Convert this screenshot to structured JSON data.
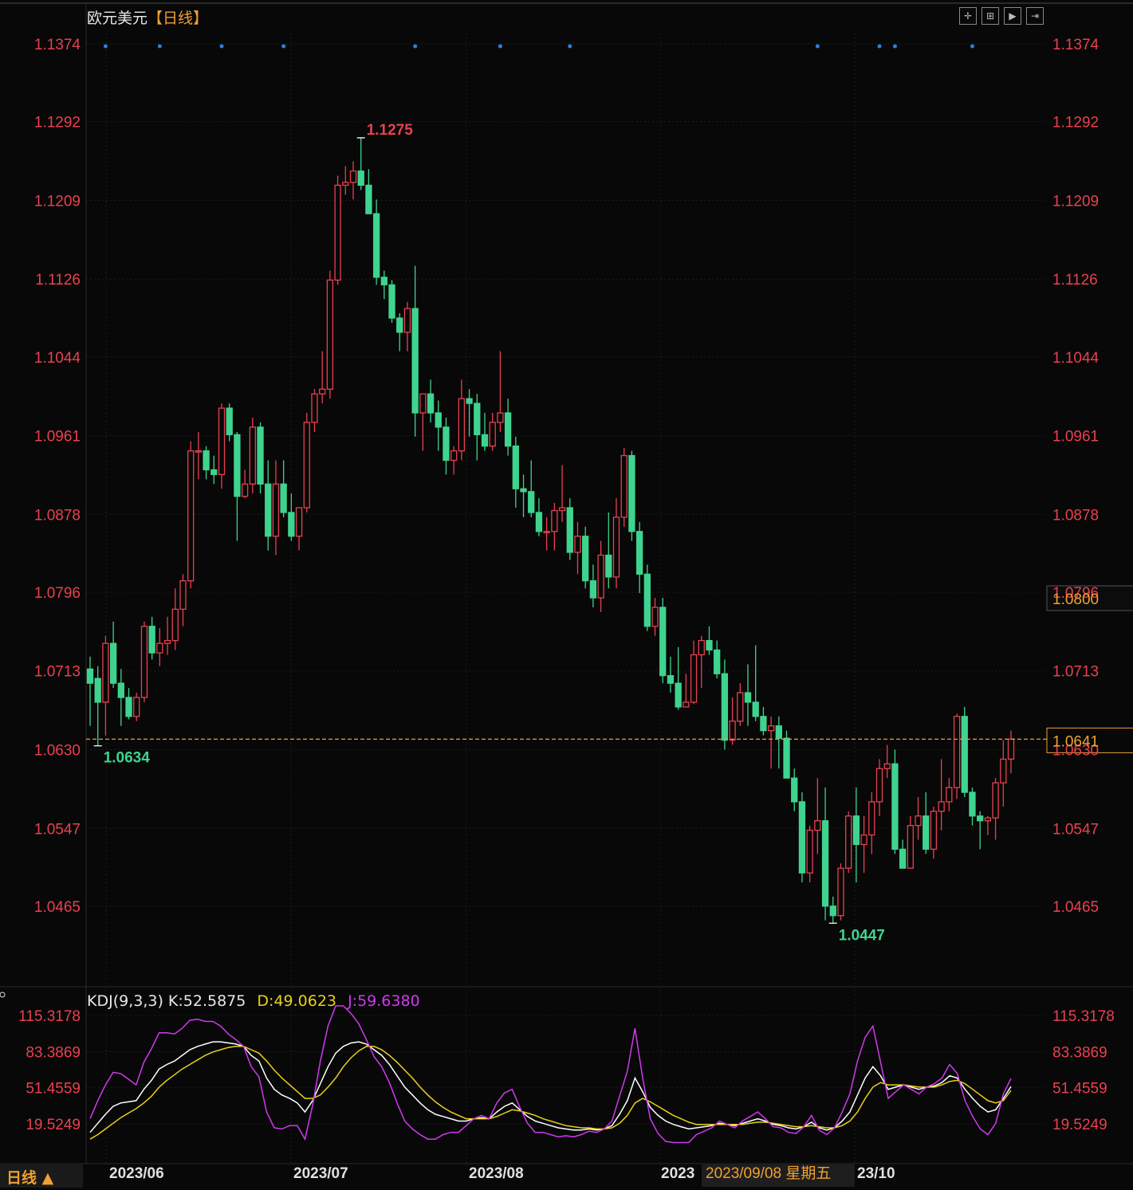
{
  "chart_title": "欧元美元",
  "period_tag": "【日线】",
  "indicator": {
    "name": "KDJ(9,3,3)",
    "k_label": "K:52.5875",
    "d_label": "D:49.0623",
    "j_label": "J:59.6380",
    "y_ticks": [
      "115.3178",
      "83.3869",
      "51.4559",
      "19.5249"
    ]
  },
  "bottom": {
    "period_label": "日线 ▲",
    "date_labels": [
      "2023/06",
      "2023/07",
      "2023/08",
      "2023",
      "23/10"
    ],
    "crosshair_date": "2023/09/08 星期五"
  },
  "price_tag_current": "1.0641",
  "price_tag_cursor": "1.0800",
  "toolbar_icons": [
    "crosshair-icon",
    "zoom-icon",
    "play-icon",
    "step-icon"
  ],
  "colors": {
    "up": "#e8414f",
    "down": "#3ed48f",
    "k": "#ffffff",
    "d": "#e8d21a",
    "j": "#d238f0",
    "current_line": "#f0a030",
    "axis_text": "#e8414f",
    "dot": "#2a82e0",
    "grid": "#1c1c1c"
  },
  "chart_data": [
    {
      "type": "candlestick",
      "series_name": "欧元美元",
      "y_ticks": [
        "1.1374",
        "1.1292",
        "1.1209",
        "1.1126",
        "1.1044",
        "1.0961",
        "1.0878",
        "1.0796",
        "1.0713",
        "1.0630",
        "1.0547",
        "1.0465"
      ],
      "ylim": [
        1.038,
        1.1385
      ],
      "annotations": {
        "high": "1.1275",
        "low": "1.0634",
        "low2": "1.0447"
      },
      "current_price": 1.0641,
      "candles": [
        [
          1.0715,
          1.0728,
          1.0655,
          1.07
        ],
        [
          1.0705,
          1.0718,
          1.0634,
          1.068
        ],
        [
          1.068,
          1.075,
          1.0645,
          1.0742
        ],
        [
          1.0742,
          1.0765,
          1.0695,
          1.07
        ],
        [
          1.07,
          1.0715,
          1.0655,
          1.0685
        ],
        [
          1.0685,
          1.0695,
          1.0662,
          1.0665
        ],
        [
          1.0665,
          1.069,
          1.066,
          1.0685
        ],
        [
          1.0685,
          1.0765,
          1.068,
          1.076
        ],
        [
          1.076,
          1.077,
          1.0725,
          1.0732
        ],
        [
          1.0732,
          1.0758,
          1.0718,
          1.0742
        ],
        [
          1.0742,
          1.077,
          1.073,
          1.0745
        ],
        [
          1.0745,
          1.08,
          1.0735,
          1.0778
        ],
        [
          1.0778,
          1.0815,
          1.076,
          1.0808
        ],
        [
          1.0808,
          1.0955,
          1.08,
          1.0945
        ],
        [
          1.0945,
          1.0965,
          1.0915,
          1.0945
        ],
        [
          1.0945,
          1.095,
          1.0915,
          1.0925
        ],
        [
          1.0925,
          1.094,
          1.091,
          1.092
        ],
        [
          1.092,
          1.0995,
          1.0905,
          1.099
        ],
        [
          1.099,
          1.0995,
          1.0955,
          1.0962
        ],
        [
          1.0962,
          1.0965,
          1.085,
          1.0897
        ],
        [
          1.0897,
          1.0925,
          1.0895,
          1.091
        ],
        [
          1.091,
          1.098,
          1.09,
          1.097
        ],
        [
          1.097,
          1.0975,
          1.09,
          1.091
        ],
        [
          1.091,
          1.0935,
          1.084,
          1.0855
        ],
        [
          1.0855,
          1.0935,
          1.0835,
          1.091
        ],
        [
          1.091,
          1.0935,
          1.0875,
          1.088
        ],
        [
          1.088,
          1.09,
          1.085,
          1.0855
        ],
        [
          1.0855,
          1.0885,
          1.084,
          1.0885
        ],
        [
          1.0885,
          1.0985,
          1.088,
          1.0975
        ],
        [
          1.0975,
          1.101,
          1.0965,
          1.1005
        ],
        [
          1.1005,
          1.105,
          1.0995,
          1.101
        ],
        [
          1.101,
          1.1135,
          1.1,
          1.1125
        ],
        [
          1.1125,
          1.1235,
          1.112,
          1.1225
        ],
        [
          1.1225,
          1.1245,
          1.1215,
          1.1228
        ],
        [
          1.1228,
          1.125,
          1.121,
          1.124
        ],
        [
          1.124,
          1.1275,
          1.122,
          1.1225
        ],
        [
          1.1225,
          1.1242,
          1.1195,
          1.1195
        ],
        [
          1.1195,
          1.121,
          1.112,
          1.1128
        ],
        [
          1.1128,
          1.1135,
          1.1105,
          1.112
        ],
        [
          1.112,
          1.1125,
          1.108,
          1.1085
        ],
        [
          1.1085,
          1.109,
          1.105,
          1.107
        ],
        [
          1.107,
          1.1102,
          1.105,
          1.1095
        ],
        [
          1.1095,
          1.114,
          1.096,
          1.0985
        ],
        [
          1.0985,
          1.1005,
          1.0945,
          1.1005
        ],
        [
          1.1005,
          1.102,
          1.0975,
          1.0985
        ],
        [
          1.0985,
          1.0998,
          1.0945,
          1.097
        ],
        [
          1.097,
          1.098,
          1.092,
          1.0935
        ],
        [
          1.0935,
          1.095,
          1.092,
          1.0945
        ],
        [
          1.0945,
          1.102,
          1.0935,
          1.1
        ],
        [
          1.1,
          1.101,
          1.096,
          1.0995
        ],
        [
          1.0995,
          1.1005,
          1.0935,
          1.0962
        ],
        [
          1.0962,
          1.0985,
          1.0945,
          1.095
        ],
        [
          1.095,
          1.0985,
          1.0945,
          1.0975
        ],
        [
          1.0975,
          1.105,
          1.0965,
          1.0985
        ],
        [
          1.0985,
          1.1,
          1.094,
          1.095
        ],
        [
          1.095,
          1.096,
          1.0885,
          1.0905
        ],
        [
          1.0905,
          1.092,
          1.0875,
          1.0902
        ],
        [
          1.0902,
          1.0935,
          1.0875,
          1.088
        ],
        [
          1.088,
          1.0895,
          1.0855,
          1.086
        ],
        [
          1.086,
          1.0875,
          1.084,
          1.086
        ],
        [
          1.086,
          1.089,
          1.084,
          1.0882
        ],
        [
          1.0882,
          1.093,
          1.087,
          1.0885
        ],
        [
          1.0885,
          1.0895,
          1.083,
          1.0838
        ],
        [
          1.0838,
          1.087,
          1.0815,
          1.0855
        ],
        [
          1.0855,
          1.0865,
          1.08,
          1.0808
        ],
        [
          1.0808,
          1.0825,
          1.078,
          1.079
        ],
        [
          1.079,
          1.085,
          1.0775,
          1.0835
        ],
        [
          1.0835,
          1.088,
          1.08,
          1.0812
        ],
        [
          1.0812,
          1.0895,
          1.08,
          1.0875
        ],
        [
          1.0875,
          1.0948,
          1.0865,
          1.094
        ],
        [
          1.094,
          1.0945,
          1.085,
          1.086
        ],
        [
          1.086,
          1.087,
          1.0795,
          1.0815
        ],
        [
          1.0815,
          1.0825,
          1.0755,
          1.076
        ],
        [
          1.076,
          1.079,
          1.075,
          1.078
        ],
        [
          1.078,
          1.079,
          1.07,
          1.0708
        ],
        [
          1.0708,
          1.0728,
          1.069,
          1.07
        ],
        [
          1.07,
          1.0738,
          1.0672,
          1.0675
        ],
        [
          1.0675,
          1.071,
          1.068,
          1.068
        ],
        [
          1.068,
          1.0745,
          1.0678,
          1.073
        ],
        [
          1.073,
          1.075,
          1.0695,
          1.0745
        ],
        [
          1.0745,
          1.076,
          1.073,
          1.0735
        ],
        [
          1.0735,
          1.0745,
          1.0705,
          1.071
        ],
        [
          1.071,
          1.0725,
          1.063,
          1.064
        ],
        [
          1.064,
          1.0685,
          1.0635,
          1.066
        ],
        [
          1.066,
          1.07,
          1.0655,
          1.069
        ],
        [
          1.069,
          1.072,
          1.0655,
          1.068
        ],
        [
          1.068,
          1.074,
          1.066,
          1.0665
        ],
        [
          1.0665,
          1.0675,
          1.0645,
          1.065
        ],
        [
          1.065,
          1.0665,
          1.061,
          1.0655
        ],
        [
          1.0655,
          1.0665,
          1.061,
          1.0642
        ],
        [
          1.0642,
          1.065,
          1.06,
          1.06
        ],
        [
          1.06,
          1.061,
          1.0565,
          1.0575
        ],
        [
          1.0575,
          1.0585,
          1.049,
          1.05
        ],
        [
          1.05,
          1.055,
          1.049,
          1.0545
        ],
        [
          1.0545,
          1.06,
          1.052,
          1.0555
        ],
        [
          1.0555,
          1.059,
          1.045,
          1.0465
        ],
        [
          1.0465,
          1.0475,
          1.0447,
          1.0455
        ],
        [
          1.0455,
          1.051,
          1.045,
          1.0505
        ],
        [
          1.0505,
          1.0565,
          1.05,
          1.056
        ],
        [
          1.056,
          1.059,
          1.049,
          1.053
        ],
        [
          1.053,
          1.056,
          1.05,
          1.054
        ],
        [
          1.054,
          1.0585,
          1.052,
          1.0575
        ],
        [
          1.0575,
          1.062,
          1.056,
          1.061
        ],
        [
          1.061,
          1.0635,
          1.06,
          1.0615
        ],
        [
          1.0615,
          1.063,
          1.052,
          1.0525
        ],
        [
          1.0525,
          1.0535,
          1.0505,
          1.0505
        ],
        [
          1.0505,
          1.056,
          1.0515,
          1.055
        ],
        [
          1.055,
          1.058,
          1.0535,
          1.056
        ],
        [
          1.056,
          1.0585,
          1.052,
          1.0525
        ],
        [
          1.0525,
          1.057,
          1.0515,
          1.0565
        ],
        [
          1.0565,
          1.062,
          1.0545,
          1.0575
        ],
        [
          1.0575,
          1.06,
          1.0565,
          1.059
        ],
        [
          1.059,
          1.0668,
          1.0578,
          1.0665
        ],
        [
          1.0665,
          1.0675,
          1.058,
          1.0585
        ],
        [
          1.0585,
          1.059,
          1.055,
          1.056
        ],
        [
          1.056,
          1.0565,
          1.0525,
          1.0555
        ],
        [
          1.0555,
          1.056,
          1.054,
          1.0558
        ],
        [
          1.0558,
          1.06,
          1.0535,
          1.0595
        ],
        [
          1.0595,
          1.064,
          1.057,
          1.062
        ],
        [
          1.062,
          1.065,
          1.0605,
          1.0641
        ]
      ],
      "blue_dot_indices": [
        2,
        9,
        17,
        25,
        42,
        53,
        62,
        94,
        102,
        104,
        114
      ]
    },
    {
      "type": "line",
      "series_name": "KDJ(9,3,3)",
      "y_ticks": [
        "115.3178",
        "83.3869",
        "51.4559",
        "19.5249"
      ],
      "ylim": [
        -12.0,
        125.0
      ],
      "series": [
        {
          "name": "K",
          "values": [
            12,
            20,
            28,
            35,
            38,
            39,
            40,
            50,
            58,
            68,
            72,
            75,
            80,
            85,
            88,
            90,
            92,
            92,
            91,
            90,
            88,
            80,
            75,
            60,
            50,
            45,
            42,
            38,
            30,
            40,
            55,
            70,
            82,
            88,
            91,
            92,
            90,
            85,
            80,
            72,
            62,
            52,
            45,
            38,
            32,
            28,
            26,
            24,
            22,
            22,
            24,
            25,
            24,
            30,
            35,
            38,
            32,
            26,
            22,
            20,
            18,
            16,
            15,
            14,
            14,
            15,
            14,
            15,
            18,
            28,
            40,
            60,
            48,
            34,
            27,
            22,
            19,
            17,
            15,
            16,
            17,
            18,
            20,
            19,
            18,
            20,
            22,
            24,
            22,
            19,
            18,
            16,
            15,
            17,
            21,
            16,
            14,
            16,
            22,
            30,
            45,
            60,
            70,
            62,
            50,
            52,
            54,
            52,
            50,
            52,
            53,
            56,
            62,
            60,
            50,
            42,
            35,
            30,
            32,
            42,
            52.5875
          ]
        },
        {
          "name": "D",
          "values": [
            6,
            10,
            15,
            20,
            25,
            29,
            33,
            38,
            44,
            52,
            58,
            63,
            68,
            72,
            76,
            80,
            83,
            85,
            87,
            88,
            88,
            85,
            82,
            75,
            67,
            60,
            54,
            48,
            42,
            42,
            45,
            52,
            60,
            70,
            78,
            84,
            88,
            88,
            85,
            80,
            74,
            67,
            60,
            52,
            45,
            39,
            34,
            30,
            27,
            24,
            24,
            24,
            24,
            26,
            29,
            32,
            31,
            29,
            27,
            24,
            22,
            20,
            18,
            17,
            16,
            16,
            15,
            15,
            16,
            20,
            27,
            38,
            42,
            39,
            35,
            31,
            27,
            24,
            21,
            19,
            19,
            19,
            19,
            19,
            19,
            19,
            20,
            21,
            21,
            20,
            19,
            18,
            17,
            17,
            18,
            17,
            16,
            16,
            18,
            22,
            30,
            42,
            52,
            56,
            54,
            54,
            54,
            53,
            52,
            52,
            52,
            54,
            57,
            58,
            55,
            50,
            45,
            40,
            38,
            40,
            49.0623
          ]
        },
        {
          "name": "J",
          "values": [
            24,
            40,
            54,
            65,
            64,
            59,
            54,
            74,
            86,
            100,
            100,
            99,
            104,
            111,
            112,
            110,
            110,
            106,
            99,
            94,
            88,
            70,
            61,
            30,
            16,
            15,
            18,
            18,
            6,
            36,
            75,
            106,
            126,
            124,
            117,
            108,
            94,
            79,
            70,
            56,
            38,
            22,
            15,
            10,
            6,
            6,
            10,
            12,
            12,
            18,
            24,
            27,
            24,
            38,
            47,
            50,
            34,
            20,
            12,
            12,
            10,
            8,
            9,
            8,
            10,
            13,
            12,
            15,
            22,
            44,
            66,
            104,
            60,
            24,
            11,
            4,
            3,
            3,
            3,
            10,
            13,
            16,
            22,
            19,
            16,
            22,
            26,
            30,
            24,
            17,
            16,
            12,
            11,
            17,
            27,
            14,
            10,
            16,
            30,
            46,
            75,
            96,
            106,
            74,
            42,
            48,
            54,
            50,
            46,
            52,
            55,
            60,
            72,
            64,
            40,
            26,
            15,
            10,
            20,
            46,
            59.638
          ]
        }
      ]
    }
  ]
}
